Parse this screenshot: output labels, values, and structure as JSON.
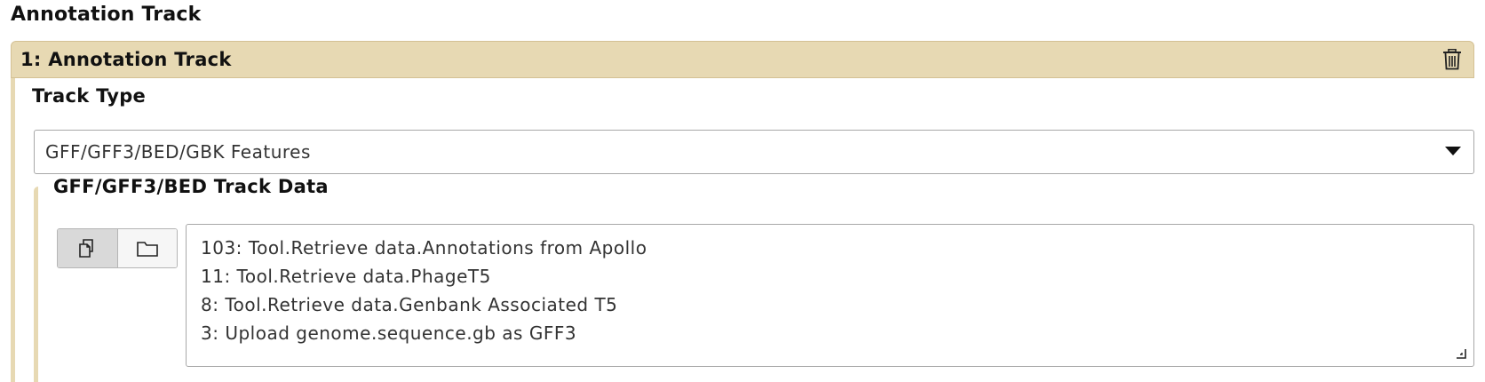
{
  "section": {
    "title": "Annotation Track"
  },
  "repeat": {
    "title": "1: Annotation Track",
    "delete_icon": "trash-icon"
  },
  "track_type": {
    "label": "Track Type",
    "selected": "GFF/GFF3/BED/GBK Features"
  },
  "track_data": {
    "label": "GFF/GFF3/BED Track Data",
    "mode_buttons": [
      {
        "icon": "multiple-datasets-icon",
        "active": true
      },
      {
        "icon": "folder-icon",
        "active": false
      }
    ],
    "selected_items": [
      "103: Tool.Retrieve data.Annotations from Apollo",
      "11: Tool.Retrieve data.PhageT5",
      "8: Tool.Retrieve data.Genbank Associated T5",
      "3: Upload genome.sequence.gb as GFF3"
    ]
  },
  "colors": {
    "header_bg": "#e7d9b3",
    "border": "#a8a8a8"
  }
}
